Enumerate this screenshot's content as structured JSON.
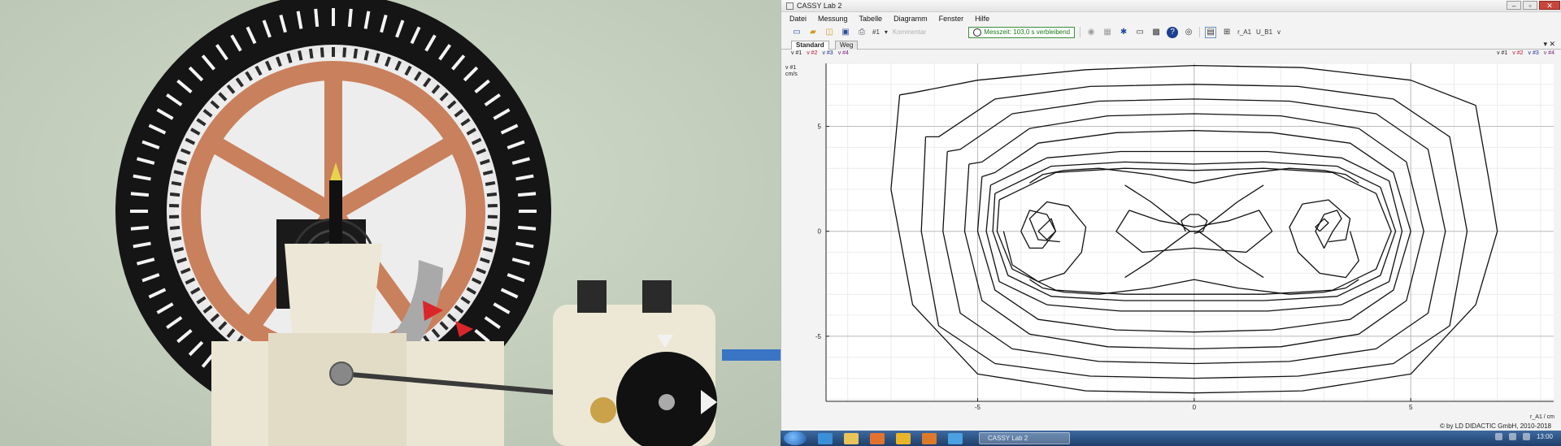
{
  "window": {
    "title": "CASSY Lab 2",
    "controls": [
      "–",
      "▫",
      "✕"
    ]
  },
  "menu": [
    "Datei",
    "Messung",
    "Tabelle",
    "Diagramm",
    "Fenster",
    "Hilfe"
  ],
  "toolbar": {
    "channel": "#1",
    "comment_placeholder": "Kommentar",
    "timer_text": "Messzeit: 103,0 s verbleibend",
    "extra_labels": [
      "r_A1",
      "U_B1",
      "v"
    ]
  },
  "tabs": [
    {
      "label": "Standard",
      "active": true
    },
    {
      "label": "Weg",
      "active": false
    }
  ],
  "legend": [
    "v #1",
    "v #2",
    "v #3",
    "v #4"
  ],
  "axis_label_y": [
    "v #1",
    "cm/s"
  ],
  "axis_label_x": "r_A1 / cm",
  "copyright": "© by LD DIDACTIC GmbH, 2010-2018",
  "taskbar": {
    "active_window": "CASSY Lab 2",
    "clock": "13:00"
  },
  "colors": {
    "timer_green": "#1b7a1b",
    "legend_red": "#c4163e",
    "legend_blue": "#1d2f8f",
    "legend_purple": "#7a1d7a",
    "taskbar": "#2a5286"
  },
  "chart_data": {
    "type": "line",
    "xlabel": "r_A1 / cm",
    "ylabel": "v #1 cm/s",
    "xticks": [
      -5,
      0,
      5
    ],
    "yticks": [
      5,
      0,
      -5
    ],
    "xlim": [
      -8.5,
      8.3
    ],
    "ylim": [
      -8.1,
      8.0
    ],
    "grid": true,
    "series": [
      {
        "x": [
          -6.8,
          -7.0,
          -6.5,
          -5.0,
          -2.5,
          0,
          2.5,
          5.0,
          6.5,
          7.0,
          6.8,
          6.5,
          5.0,
          2.5,
          0,
          -2.5,
          -5.0,
          -6.5,
          -6.8
        ],
        "y": [
          6.5,
          2.0,
          -3.5,
          -6.8,
          -7.6,
          -7.7,
          -7.6,
          -6.8,
          -3.5,
          0,
          2.5,
          6.0,
          7.2,
          7.8,
          7.9,
          7.7,
          7.2,
          6.6,
          6.5
        ]
      },
      {
        "x": [
          -6.2,
          -6.3,
          -5.9,
          -4.6,
          -2.4,
          0,
          2.4,
          4.6,
          5.9,
          6.3,
          5.9,
          4.6,
          2.4,
          0,
          -2.4,
          -4.6,
          -5.9,
          -6.2
        ],
        "y": [
          4.5,
          0,
          -4.5,
          -6.3,
          -6.9,
          -7.0,
          -6.9,
          -6.3,
          -4.5,
          0,
          4.5,
          6.3,
          6.9,
          7.0,
          6.9,
          6.3,
          4.5,
          4.5
        ]
      },
      {
        "x": [
          -5.7,
          -5.8,
          -5.4,
          -4.2,
          -2.2,
          0,
          2.2,
          4.2,
          5.4,
          5.8,
          5.4,
          4.2,
          2.2,
          0,
          -2.2,
          -4.2,
          -5.4,
          -5.7
        ],
        "y": [
          3.8,
          0,
          -3.9,
          -5.6,
          -6.2,
          -6.3,
          -6.2,
          -5.6,
          -3.9,
          0,
          3.9,
          5.6,
          6.2,
          6.3,
          6.2,
          5.6,
          3.9,
          3.8
        ]
      },
      {
        "x": [
          -5.2,
          -5.3,
          -4.9,
          -3.8,
          -2.0,
          0,
          2.0,
          3.8,
          4.9,
          5.3,
          4.9,
          3.8,
          2.0,
          0,
          -2.0,
          -3.8,
          -4.9,
          -5.2
        ],
        "y": [
          3.2,
          0,
          -3.3,
          -4.9,
          -5.5,
          -5.6,
          -5.5,
          -4.9,
          -3.3,
          0,
          3.3,
          4.9,
          5.5,
          5.6,
          5.5,
          4.9,
          3.3,
          3.2
        ]
      },
      {
        "x": [
          -4.9,
          -5.0,
          -4.6,
          -3.6,
          -1.8,
          0,
          1.8,
          3.6,
          4.6,
          5.0,
          4.6,
          3.6,
          1.8,
          0,
          -1.8,
          -3.6,
          -4.6,
          -4.9
        ],
        "y": [
          2.6,
          0,
          -2.8,
          -4.2,
          -4.7,
          -4.8,
          -4.7,
          -4.2,
          -2.8,
          0,
          2.8,
          4.2,
          4.7,
          4.8,
          4.7,
          4.2,
          2.8,
          2.6
        ]
      },
      {
        "x": [
          -4.7,
          -4.8,
          -4.5,
          -3.4,
          -1.7,
          0,
          1.7,
          3.4,
          4.5,
          4.8,
          4.5,
          3.4,
          1.7,
          0,
          -1.7,
          -3.4,
          -4.5,
          -4.7
        ],
        "y": [
          2.2,
          0,
          -2.4,
          -3.5,
          -3.8,
          -3.8,
          -3.8,
          -3.5,
          -2.4,
          0,
          2.4,
          3.5,
          3.8,
          3.8,
          3.8,
          3.5,
          2.4,
          2.2
        ]
      },
      {
        "x": [
          -4.6,
          -4.65,
          -4.3,
          -3.3,
          -1.6,
          0,
          1.6,
          3.3,
          4.3,
          4.65,
          4.3,
          3.3,
          1.6,
          0,
          -1.6,
          -3.3,
          -4.3,
          -4.6
        ],
        "y": [
          1.8,
          0,
          -2.1,
          -3.1,
          -3.3,
          -3.3,
          -3.3,
          -3.1,
          -2.1,
          0,
          2.1,
          3.1,
          3.3,
          3.2,
          3.3,
          3.1,
          2.1,
          1.8
        ]
      },
      {
        "x": [
          -4.5,
          -4.55,
          -4.2,
          -3.2,
          -1.6,
          0,
          1.6,
          3.2,
          4.2,
          4.55,
          4.2,
          3.2,
          1.6,
          0,
          -1.6,
          -3.2,
          -4.2,
          -4.5
        ],
        "y": [
          1.5,
          0,
          -1.8,
          -2.8,
          -3.0,
          -3.0,
          -3.0,
          -2.8,
          -1.8,
          0,
          1.8,
          2.8,
          3.0,
          2.9,
          3.0,
          2.8,
          1.8,
          1.5
        ]
      },
      {
        "x": [
          -4.4,
          -4.2,
          -3.6,
          -3.0,
          -2.6,
          -2.5,
          -2.9,
          -3.4,
          -3.8,
          -3.6,
          -3.1
        ],
        "y": [
          0,
          -1.6,
          -2.4,
          -2.0,
          -1.0,
          0.2,
          1.2,
          1.4,
          0.6,
          -0.4,
          -0.5
        ]
      },
      {
        "x": [
          -4.0,
          -3.8,
          -3.4,
          -3.2,
          -3.5,
          -3.8,
          -4.0
        ],
        "y": [
          0,
          1.0,
          0.8,
          0,
          -0.8,
          -0.8,
          0
        ]
      },
      {
        "x": [
          -3.6,
          -3.3,
          -3.2,
          -3.4,
          -3.6
        ],
        "y": [
          0,
          0.6,
          0,
          -0.4,
          0
        ]
      },
      {
        "x": [
          3.6,
          3.8,
          3.5,
          2.9,
          2.4,
          2.2,
          2.5,
          3.1,
          3.6,
          3.5,
          3.1
        ],
        "y": [
          0,
          -1.4,
          -2.2,
          -2.0,
          -1.0,
          0.2,
          1.3,
          1.5,
          0.6,
          -0.4,
          -0.5
        ]
      },
      {
        "x": [
          3.2,
          3.4,
          3.3,
          3.0,
          2.8,
          3.0,
          3.2
        ],
        "y": [
          0,
          0.6,
          1.0,
          0.8,
          0,
          -0.8,
          0
        ]
      },
      {
        "x": [
          2.9,
          3.1,
          3.0,
          2.8,
          2.9
        ],
        "y": [
          0,
          0.4,
          0.6,
          0.2,
          0
        ]
      },
      {
        "x": [
          -1.6,
          -1.0,
          -0.5,
          -0.1,
          0.1,
          0.5,
          1.0,
          1.6
        ],
        "y": [
          2.2,
          1.4,
          0.6,
          0.0,
          0.0,
          0.6,
          1.4,
          2.2
        ]
      },
      {
        "x": [
          -1.6,
          -1.0,
          -0.5,
          -0.1,
          0.1,
          0.5,
          1.0,
          1.6
        ],
        "y": [
          -2.2,
          -1.4,
          -0.6,
          0.0,
          0.0,
          -0.6,
          -1.4,
          -2.2
        ]
      },
      {
        "x": [
          -0.2,
          -0.3,
          -0.1,
          0.1,
          0.3,
          0.2,
          0
        ],
        "y": [
          0,
          0.5,
          0.8,
          0.8,
          0.5,
          0,
          -0.1
        ]
      },
      {
        "x": [
          -3.8,
          -3.5,
          -3.0,
          -2.2,
          -1.0,
          0,
          1.0,
          2.2,
          3.0,
          3.5,
          3.8
        ],
        "y": [
          2.3,
          2.7,
          2.9,
          3.0,
          2.7,
          2.3,
          2.7,
          3.0,
          2.9,
          2.7,
          2.3
        ]
      },
      {
        "x": [
          -3.8,
          -3.5,
          -3.0,
          -2.2,
          -1.0,
          0,
          1.0,
          2.2,
          3.0,
          3.5,
          3.8
        ],
        "y": [
          -2.3,
          -2.7,
          -2.9,
          -3.0,
          -2.7,
          -2.3,
          -2.7,
          -3.0,
          -2.9,
          -2.7,
          -2.3
        ]
      },
      {
        "x": [
          -1.5,
          -0.8,
          0,
          0.8,
          1.5,
          1.8,
          1.2,
          0,
          -1.2,
          -1.8,
          -1.5
        ],
        "y": [
          1.0,
          0.5,
          0.2,
          0.5,
          1.0,
          0,
          -1.0,
          -0.8,
          -1.0,
          0,
          1.0
        ]
      }
    ]
  }
}
